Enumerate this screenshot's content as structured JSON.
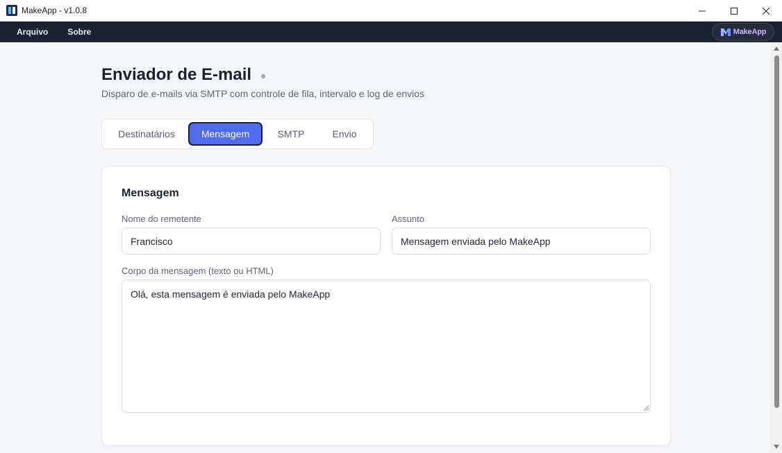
{
  "window": {
    "title": "MakeApp - v1.0.8"
  },
  "menu": {
    "items": [
      "Arquivo",
      "Sobre"
    ],
    "brand": "MakeApp"
  },
  "header": {
    "title": "Enviador de E-mail",
    "subtitle": "Disparo de e-mails via SMTP com controle de fila, intervalo e log de envios"
  },
  "tabs": [
    {
      "label": "Destinatários",
      "active": false
    },
    {
      "label": "Mensagem",
      "active": true
    },
    {
      "label": "SMTP",
      "active": false
    },
    {
      "label": "Envio",
      "active": false
    }
  ],
  "card": {
    "title": "Mensagem",
    "sender_label": "Nome do remetente",
    "sender_value": "Francisco",
    "subject_label": "Assunto",
    "subject_value": "Mensagem enviada pelo MakeApp",
    "body_label": "Corpo da mensagem (texto ou HTML)",
    "body_value": "Olá, esta mensagem é enviada pelo MakeApp"
  },
  "colors": {
    "menubar": "#1b2232",
    "accent": "#4f6bf0",
    "brand_text": "#c9b8ff"
  }
}
